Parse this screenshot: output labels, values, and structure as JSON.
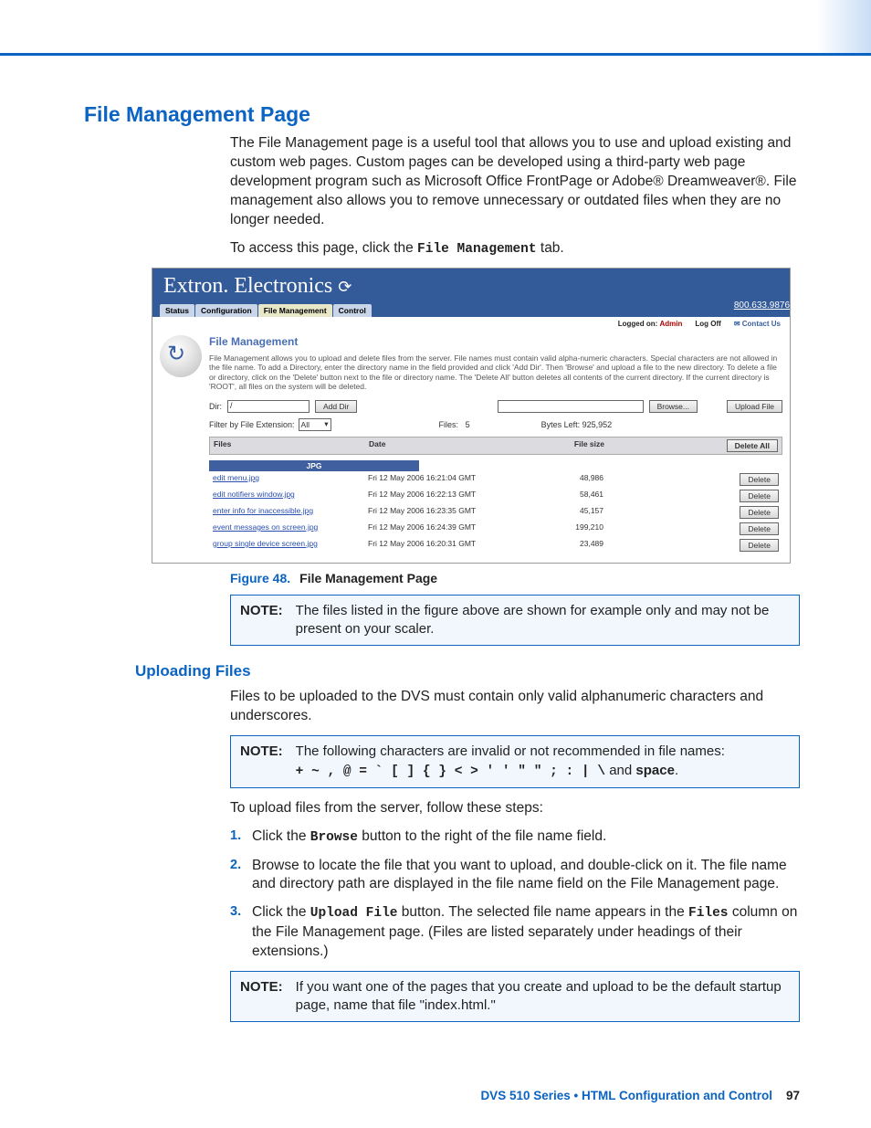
{
  "headings": {
    "h1": "File Management Page",
    "h2_upload": "Uploading Files"
  },
  "intro": {
    "p1": "The File Management page is a useful tool that allows you to use and upload existing and custom web pages. Custom pages can be developed using a third-party web page development program such as Microsoft Office FrontPage or Adobe® Dreamweaver®. File management also allows you to remove unnecessary or outdated files when they are no longer needed.",
    "p2_a": "To access this page, click the ",
    "p2_code": "File Management",
    "p2_b": " tab."
  },
  "figure": {
    "brand": "Extron. Electronics",
    "phone": "800.633.9876",
    "tabs": [
      "Status",
      "Configuration",
      "File Management",
      "Control"
    ],
    "active_tab": 2,
    "substrip": {
      "logon_label": "Logged on:",
      "logon_user": "Admin",
      "logoff": "Log Off",
      "contact": "Contact Us"
    },
    "title": "File Management",
    "desc": "File Management allows you to upload and delete files from the server. File names must contain valid alpha-numeric characters. Special characters are not allowed in the file name. To add a Directory, enter the directory name in the field provided and click 'Add Dir'. Then 'Browse' and upload a file to the new directory. To delete a file or directory, click on the 'Delete' button next to the file or directory name. The 'Delete All' button deletes all contents of the current directory. If the current directory is 'ROOT', all files on the system will be deleted.",
    "dir_label": "Dir:",
    "dir_value": "/",
    "add_dir": "Add Dir",
    "browse": "Browse...",
    "upload": "Upload File",
    "filter_label": "Filter by File Extension:",
    "filter_value": "All",
    "files_label": "Files:",
    "files_count": "5",
    "bytes_label": "Bytes Left: 925,952",
    "th": {
      "files": "Files",
      "date": "Date",
      "size": "File size",
      "delall": "Delete All"
    },
    "group": "JPG",
    "rows": [
      {
        "name": "edit menu.jpg",
        "date": "Fri 12 May 2006 16:21:04 GMT",
        "size": "48,986",
        "btn": "Delete"
      },
      {
        "name": "edit notifiers window.jpg",
        "date": "Fri 12 May 2006 16:22:13 GMT",
        "size": "58,461",
        "btn": "Delete"
      },
      {
        "name": "enter info for inaccessible.jpg",
        "date": "Fri 12 May 2006 16:23:35 GMT",
        "size": "45,157",
        "btn": "Delete"
      },
      {
        "name": "event messages on screen.jpg",
        "date": "Fri 12 May 2006 16:24:39 GMT",
        "size": "199,210",
        "btn": "Delete"
      },
      {
        "name": "group single device screen.jpg",
        "date": "Fri 12 May 2006 16:20:31 GMT",
        "size": "23,489",
        "btn": "Delete"
      }
    ]
  },
  "caption": {
    "label": "Figure 48.",
    "text": "File Management Page"
  },
  "note1": {
    "label": "NOTE:",
    "body": "The files listed in the figure above are shown for example only and may not be present on your scaler."
  },
  "upload": {
    "p1": "Files to be uploaded to the DVS must contain only valid alphanumeric characters and underscores.",
    "note": {
      "label": "NOTE:",
      "line1": "The following characters are invalid or not recommended in file names:",
      "chars": "+ ~ , @ = ` [ ] { } < > ' ' \" \" ; : | \\",
      "and": " and ",
      "space": "space",
      "period": "."
    },
    "p2": "To upload files from the server, follow these steps:",
    "steps": {
      "s1_a": "Click the ",
      "s1_code": "Browse",
      "s1_b": " button to the right of the file name field.",
      "s2": "Browse to locate the file that you want to upload, and double-click on it. The file name and directory path are displayed in the file name field on the File Management page.",
      "s3_a": "Click the ",
      "s3_code1": "Upload File",
      "s3_b": " button. The selected file name appears in the ",
      "s3_code2": "Files",
      "s3_c": " column on the File Management page. (Files are listed separately under headings of their extensions.)"
    },
    "note2": {
      "label": "NOTE:",
      "body": "If you want one of the pages that you create and upload to be the default startup page, name that file \"index.html.\""
    }
  },
  "footer": {
    "title": "DVS 510 Series • HTML Configuration and Control",
    "page": "97"
  }
}
